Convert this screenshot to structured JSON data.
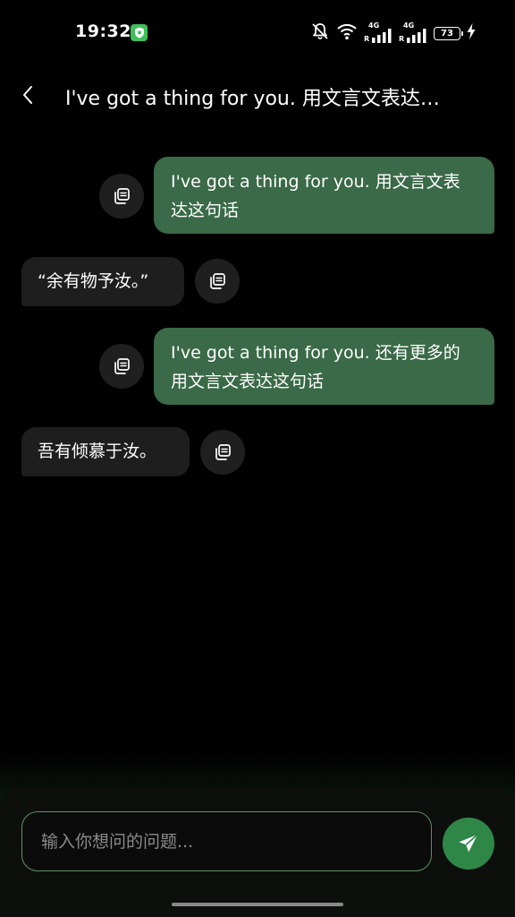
{
  "status_bar": {
    "time": "19:32",
    "network_gen_1": "4G",
    "network_gen_2": "4G",
    "roaming_1": "R",
    "roaming_2": "R",
    "battery_level": "73"
  },
  "header": {
    "title": "I've got a thing for you. 用文言文表达这句话"
  },
  "messages": [
    {
      "role": "user",
      "text": "I've got a thing for you. 用文言文表达这句话"
    },
    {
      "role": "assistant",
      "text": "“余有物予汝。”"
    },
    {
      "role": "user",
      "text": "I've got a thing for you. 还有更多的用文言文表达这句话"
    },
    {
      "role": "assistant",
      "text": "吾有倾慕于汝。"
    }
  ],
  "composer": {
    "placeholder": "输入你想问的问题...",
    "value": ""
  },
  "colors": {
    "background": "#000000",
    "user_bubble": "#3a6a47",
    "assistant_bubble": "#1e1e1e",
    "accent": "#2f8747",
    "input_border": "#5f8f66"
  },
  "icons": {
    "back": "chevron-left-icon",
    "copy": "copy-icon",
    "send": "send-icon",
    "shield": "shield-icon",
    "mute": "bell-off-icon",
    "wifi": "wifi-icon",
    "signal": "signal-icon",
    "battery": "battery-icon",
    "charging": "lightning-icon"
  }
}
